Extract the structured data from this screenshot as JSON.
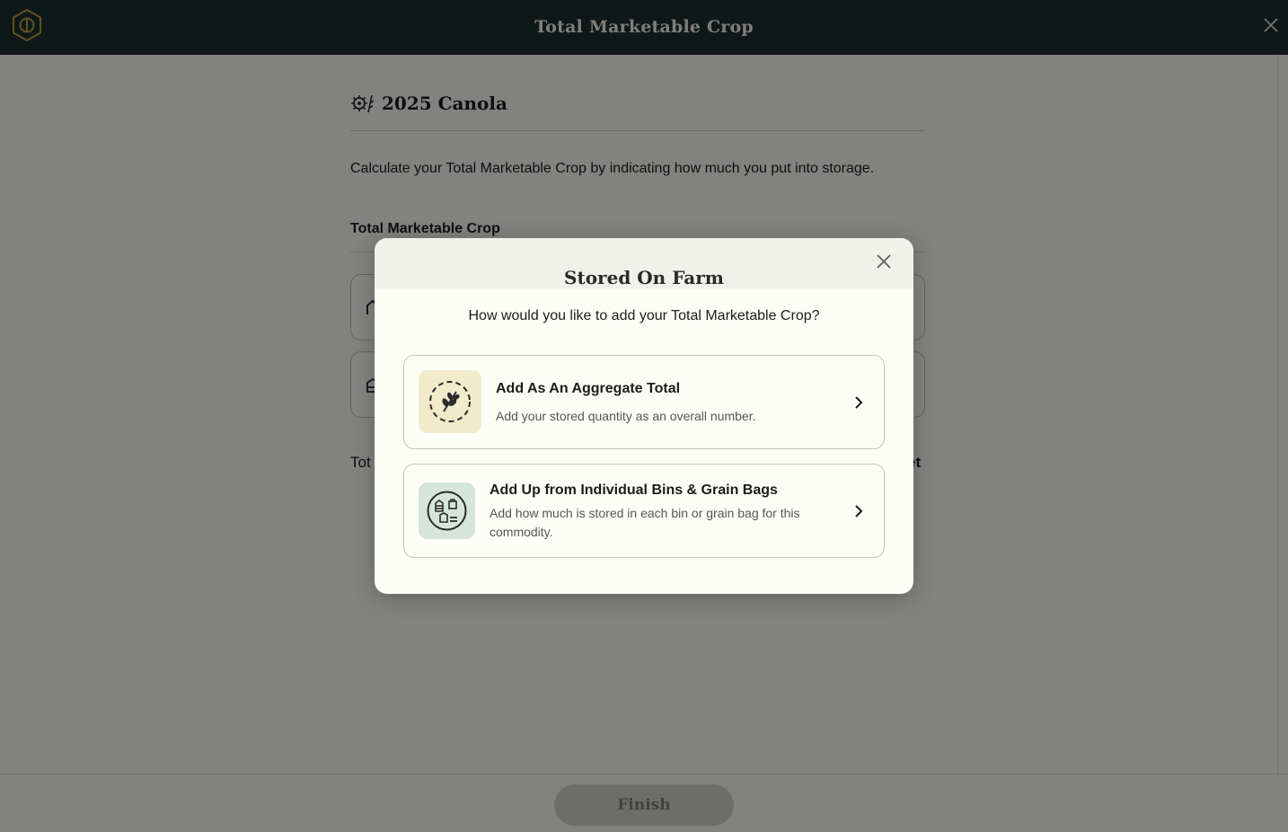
{
  "header": {
    "title": "Total Marketable Crop",
    "logo_icon": "hexagon-logo-icon",
    "close_icon": "close-icon"
  },
  "page": {
    "crop_title": "2025 Canola",
    "crop_icon": "canola-icon",
    "intro": "Calculate your Total Marketable Crop by indicating how much you put into storage.",
    "section_label": "Total Marketable Crop",
    "total_left_partial": "Tot",
    "total_right_partial": "et"
  },
  "footer": {
    "finish_label": "Finish"
  },
  "modal": {
    "title": "Stored On Farm",
    "question": "How would you like to add your Total Marketable Crop?",
    "options": [
      {
        "title": "Add As An Aggregate Total",
        "description": "Add your stored quantity as an overall number.",
        "icon": "grain-circle-icon",
        "icon_bg": "#f1ebcc"
      },
      {
        "title": "Add Up from Individual Bins & Grain Bags",
        "description": "Add how much is stored in each bin or grain bag for this commodity.",
        "icon": "bins-icon",
        "icon_bg": "#d5e5dc"
      }
    ]
  },
  "colors": {
    "header_bg": "#1b2f2e",
    "logo_gold": "#b89a3a",
    "overlay": "rgba(0,0,0,0.47)"
  }
}
